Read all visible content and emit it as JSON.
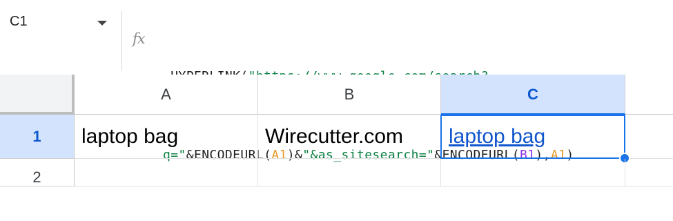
{
  "name_box": {
    "value": "C1",
    "dropdown_icon": "chevron-down-icon"
  },
  "formula_bar": {
    "fx_label": "fx",
    "formula": {
      "line1": [
        {
          "t": "=HYPERLINK(",
          "k": "plain"
        },
        {
          "t": "\"https://www.google.com/search?",
          "k": "string"
        }
      ],
      "line2": [
        {
          "t": "q=\"",
          "k": "string"
        },
        {
          "t": "&ENCODEURL(",
          "k": "plain"
        },
        {
          "t": "A1",
          "k": "ref_a"
        },
        {
          "t": ")&",
          "k": "plain"
        },
        {
          "t": "\"&as_sitesearch=\"",
          "k": "string"
        },
        {
          "t": "&ENCODEURL(",
          "k": "plain"
        },
        {
          "t": "B1",
          "k": "ref_b"
        },
        {
          "t": "),",
          "k": "plain"
        },
        {
          "t": "A1",
          "k": "ref_a"
        },
        {
          "t": ")",
          "k": "plain"
        }
      ]
    }
  },
  "grid": {
    "columns": [
      "A",
      "B",
      "C"
    ],
    "rows": [
      "1",
      "2"
    ],
    "cells": {
      "A1": "laptop bag",
      "B1": "Wirecutter.com",
      "C1": "laptop bag"
    },
    "selected_cell": "C1",
    "selected_column": "C",
    "selected_row": "1"
  },
  "colors": {
    "accent": "#1a73e8",
    "selected_header_bg": "#d3e3fd",
    "string_token": "#0b8043",
    "ref_a_token": "#e69a28",
    "ref_b_token": "#9334e6",
    "link": "#1155cc"
  }
}
